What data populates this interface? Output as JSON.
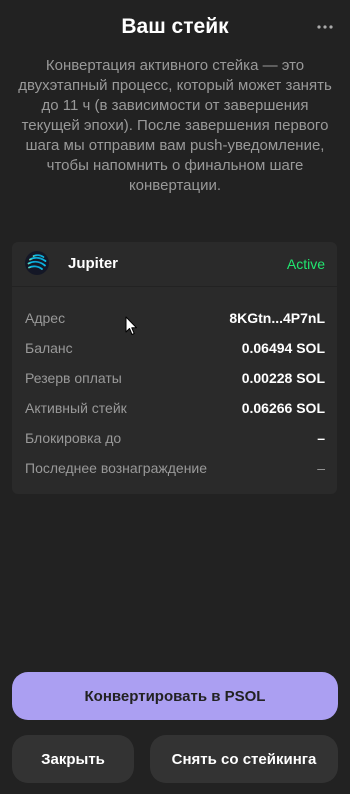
{
  "header": {
    "title": "Ваш стейк",
    "menu_icon": "more-horizontal-icon"
  },
  "description": "Конвертация активного стейка — это двухэтапный процесс, который может занять до 11 ч (в зависимости от завершения текущей эпохи). После завершения первого шага мы отправим вам push-уведомление, чтобы напомнить о финальном шаге конвертации.",
  "validator": {
    "name": "Jupiter",
    "status": "Active",
    "status_color": "#21E56F",
    "logo_icon": "jupiter-logo-icon"
  },
  "details": [
    {
      "label": "Адрес",
      "value": "8KGtn...4P7nL"
    },
    {
      "label": "Баланс",
      "value": "0.06494 SOL"
    },
    {
      "label": "Резерв оплаты",
      "value": "0.00228 SOL"
    },
    {
      "label": "Активный стейк",
      "value": "0.06266 SOL"
    },
    {
      "label": "Блокировка до",
      "value": "–"
    },
    {
      "label": "Последнее вознаграждение",
      "value": "–"
    }
  ],
  "buttons": {
    "convert": "Конвертировать в PSOL",
    "close": "Закрыть",
    "unstake": "Снять со стейкинга"
  },
  "colors": {
    "background": "#222222",
    "card": "#2A2A2A",
    "accent": "#AB9FF2",
    "secondary_button": "#333333",
    "muted_text": "#999999"
  }
}
